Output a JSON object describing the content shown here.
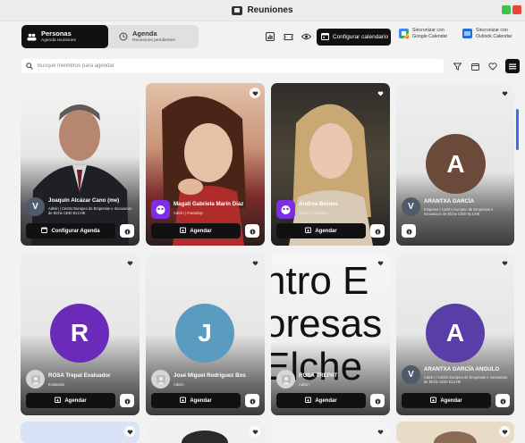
{
  "window": {
    "title": "Reuniones"
  },
  "toolbar": {
    "tabs": [
      {
        "label": "Personas",
        "sublabel": "Agenda reuniones"
      },
      {
        "label": "Agenda",
        "sublabel": "Reuniones pendientes"
      }
    ],
    "config_calendar_label": "Configurar calendario",
    "sync_google": [
      "Sincronizar con",
      "Google Calendar"
    ],
    "sync_outlook": [
      "Sincronizar con",
      "Outlook Calendar"
    ]
  },
  "search": {
    "placeholder": "Busque miembros para agendar"
  },
  "colors": {
    "accent": "#3b6ef5",
    "dark": "#111111",
    "brown": "#6b4a3a",
    "purple": "#6a2bb8",
    "teal": "#5a9bc0",
    "violet": "#5a3ea8"
  },
  "cards": [
    {
      "name": "Joaquín Alcázar Cano (me)",
      "role": "Admin | Centro Europeo de Empresas e Innovacion de Elche CEEI ELCHE",
      "avatar": "V",
      "action": "Configurar Agenda"
    },
    {
      "name": "Magalí Gabriela Marín Díaz",
      "role": "Admin | FractalUp",
      "avatar": "",
      "action": "Agendar"
    },
    {
      "name": "Andrea Bernes",
      "role": "Admin | FractalUp",
      "avatar": "",
      "action": "Agendar"
    },
    {
      "name": "ARANTXA GARCÍA",
      "role": "Empresa | Centro Europeo de Empresas e Innovacion de Elche CEEI ELCHE",
      "avatar": "V",
      "big_letter": "A",
      "action": ""
    },
    {
      "name": "ROSA Trepat Evaluador",
      "role": "Evaluador",
      "avatar": "",
      "big_letter": "R",
      "action": "Agendar"
    },
    {
      "name": "José Miguel Rodríguez Bos",
      "role": "Admin",
      "avatar": "",
      "big_letter": "J",
      "action": "Agendar"
    },
    {
      "name": "ROSA TREPAT",
      "role": "Admin",
      "avatar": "",
      "action": "Agendar",
      "background_text": [
        "ntro E",
        "oresas",
        "Elche"
      ]
    },
    {
      "name": "ARANTXA GARCÍA ANGULO",
      "role": "Admin | Centro Europeo de Empresas e Innovacion de Elche CEEI ELCHE",
      "avatar": "V",
      "big_letter": "A",
      "action": "Agendar"
    }
  ]
}
